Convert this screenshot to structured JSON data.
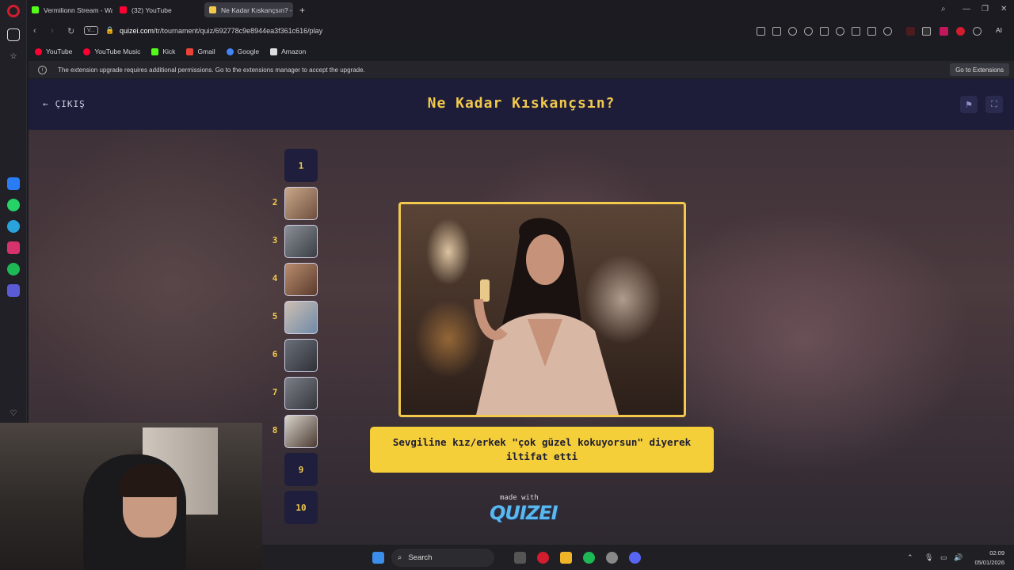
{
  "browser": {
    "tabs": [
      {
        "label": "Vermilionn Stream - Watc",
        "color": "#53fc18"
      },
      {
        "label": "(32) YouTube",
        "color": "#ff0033"
      },
      {
        "label": "Ne Kadar Kıskançsın? - Tir",
        "color": "#f2c94c"
      }
    ],
    "url_prefix": "quizei.com",
    "url_path": "/tr/tournament/quiz/692778c9e8944ea3f361c616/play",
    "url_badge": "V...",
    "bookmarks": [
      "YouTube",
      "YouTube Music",
      "Kick",
      "Gmail",
      "Google",
      "Amazon"
    ],
    "info_message": "The extension upgrade requires additional permissions. Go to the extensions manager to accept the upgrade.",
    "extensions_button": "Go to Extensions",
    "ai_label": "AI"
  },
  "page": {
    "exit_label": "ÇIKIŞ",
    "title": "Ne Kadar Kıskançsın?",
    "rounds": [
      "1",
      "2",
      "3",
      "4",
      "5",
      "6",
      "7",
      "8",
      "9",
      "10"
    ],
    "question": "Sevgiline kız/erkek \"çok güzel kokuyorsun\" diyerek iltifat etti",
    "made_with": "made with",
    "brand": "QUIZEI"
  },
  "taskbar": {
    "search_label": "Search",
    "time": "02:09",
    "date": "05/01/2026"
  }
}
